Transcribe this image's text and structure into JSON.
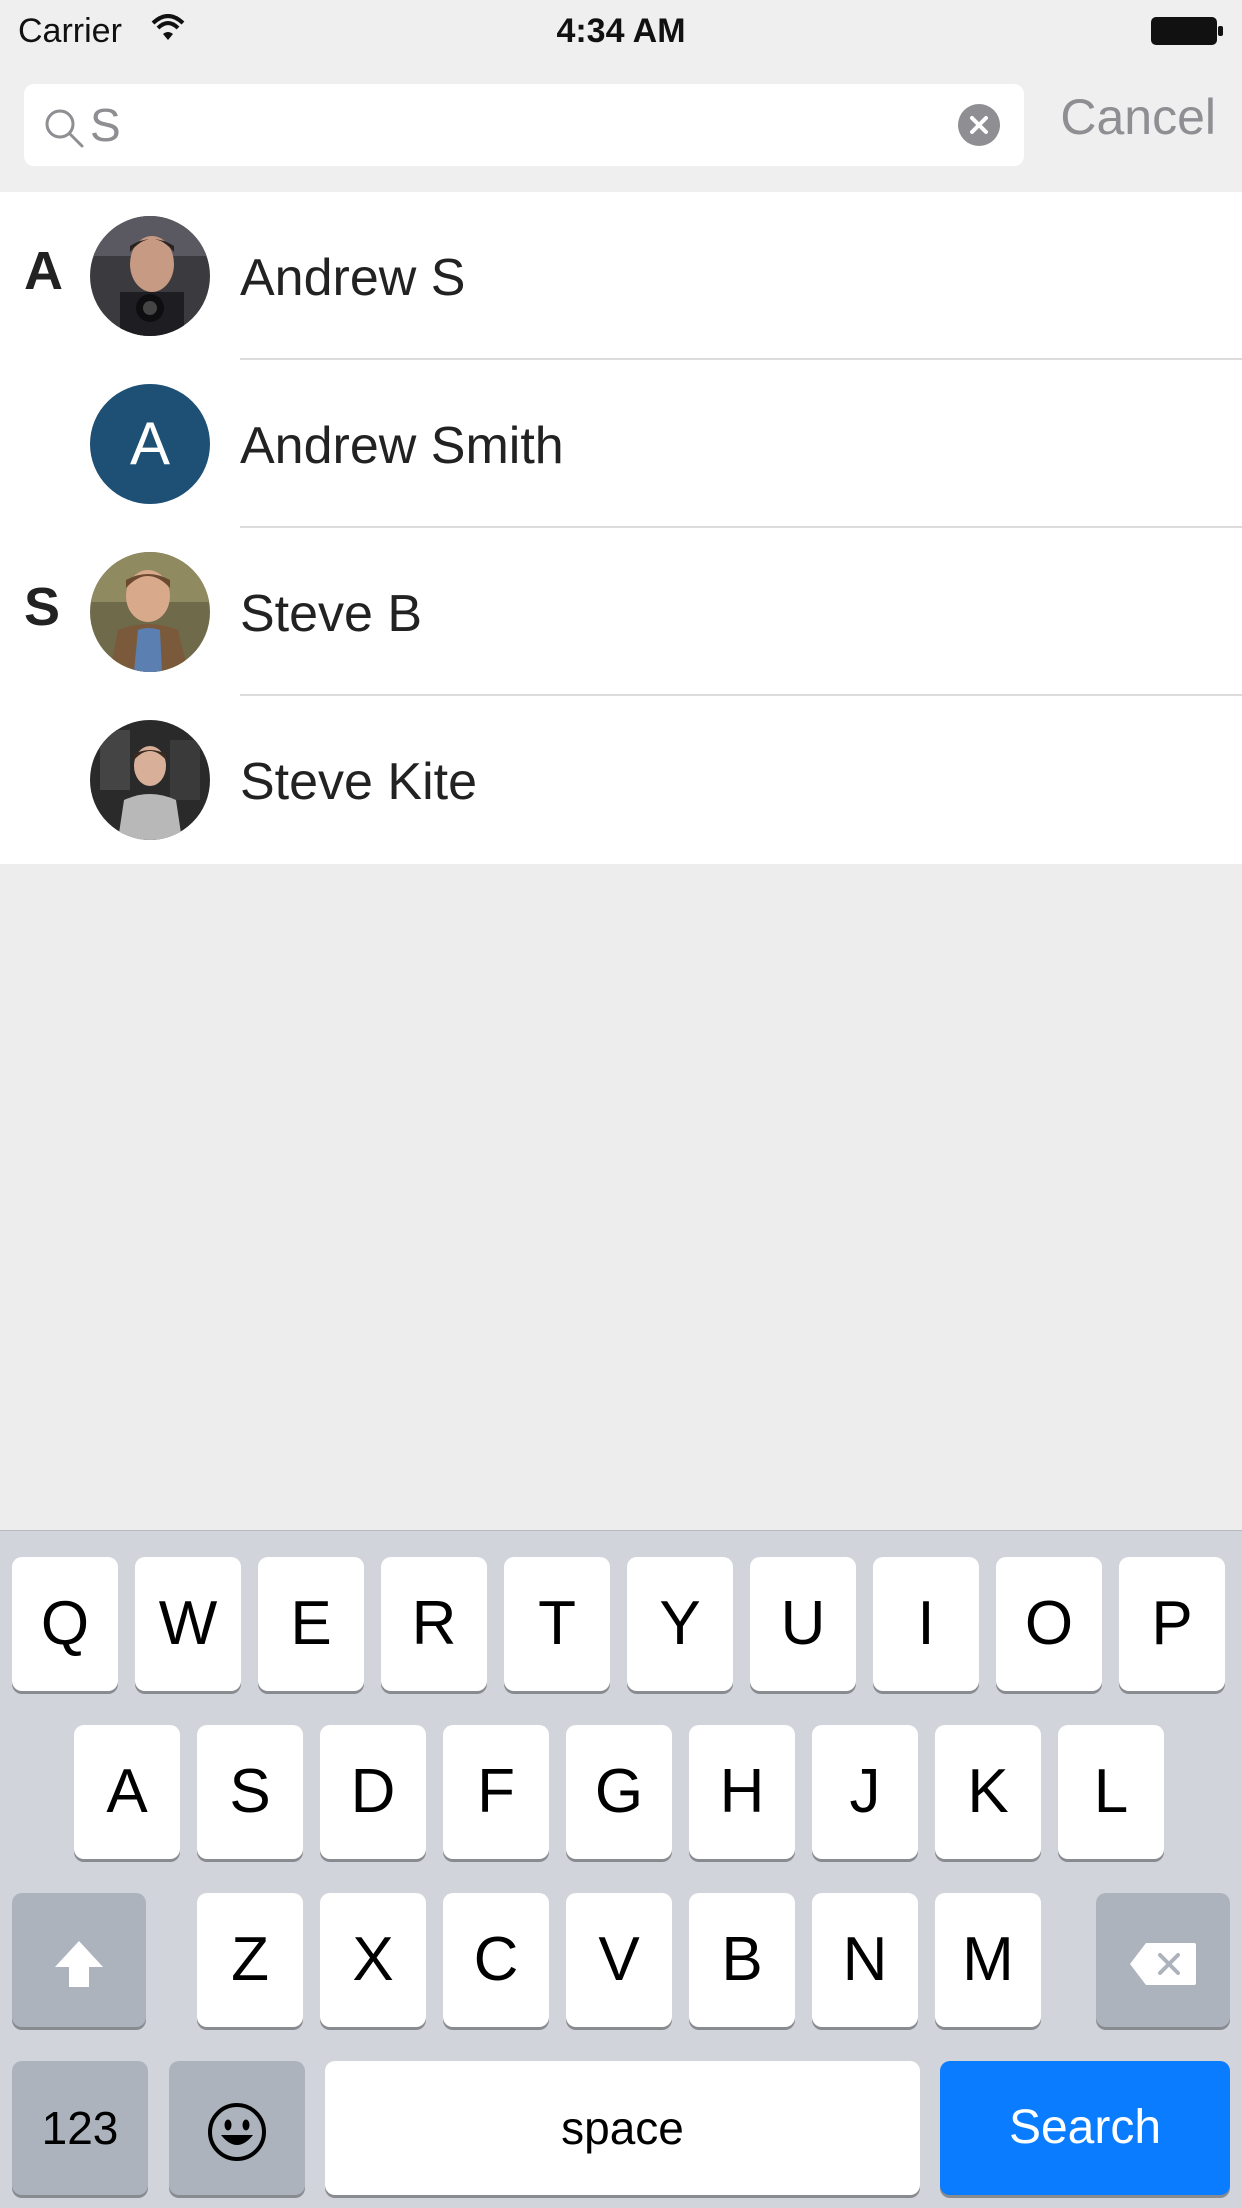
{
  "status_bar": {
    "carrier": "Carrier",
    "time": "4:34 AM",
    "icons": [
      "wifi-icon",
      "battery-icon"
    ]
  },
  "search": {
    "value": "S",
    "placeholder": "",
    "cancel_label": "Cancel",
    "icons": [
      "search-icon",
      "clear-icon"
    ]
  },
  "contacts": [
    {
      "section": "A",
      "name": "Andrew S",
      "avatar": "photo"
    },
    {
      "section": "",
      "name": "Andrew Smith",
      "avatar": "initial",
      "initial": "A"
    },
    {
      "section": "S",
      "name": "Steve B",
      "avatar": "photo"
    },
    {
      "section": "",
      "name": "Steve Kite",
      "avatar": "photo"
    }
  ],
  "keyboard": {
    "row1": [
      "Q",
      "W",
      "E",
      "R",
      "T",
      "Y",
      "U",
      "I",
      "O",
      "P"
    ],
    "row2": [
      "A",
      "S",
      "D",
      "F",
      "G",
      "H",
      "J",
      "K",
      "L"
    ],
    "row3": [
      "Z",
      "X",
      "C",
      "V",
      "B",
      "N",
      "M"
    ],
    "numbers_label": "123",
    "space_label": "space",
    "search_label": "Search",
    "icons": [
      "shift-icon",
      "backspace-icon",
      "emoji-icon"
    ]
  },
  "colors": {
    "accent": "#0a7cff",
    "avatar_initial_bg": "#1e4f74",
    "muted_text": "#8e8e93"
  }
}
